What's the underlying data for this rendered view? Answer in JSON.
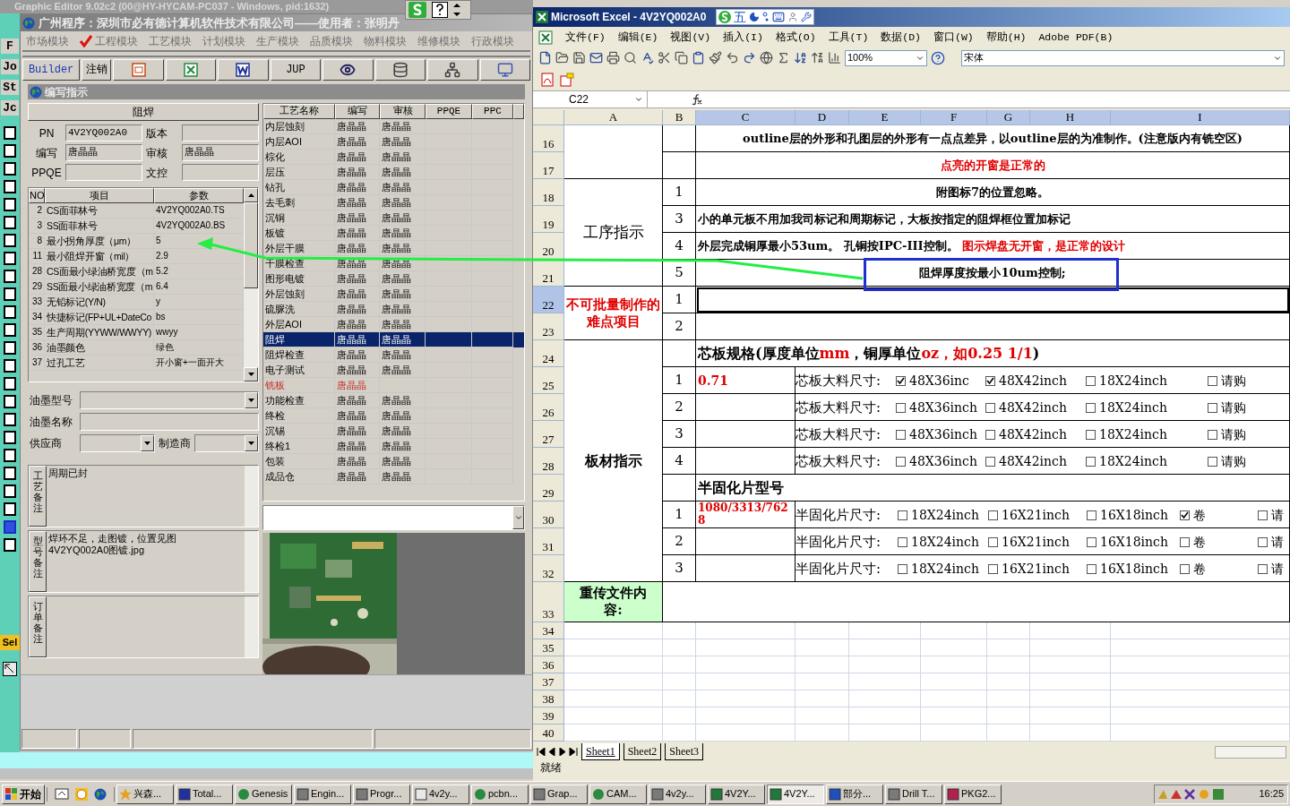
{
  "editor": {
    "title": "Graphic Editor 9.02c2 (00@HY-HYCAM-PC037 - Windows, pid:1632)",
    "side_labels": [
      "F",
      "Jo",
      "St",
      "Jc"
    ],
    "tool_label": "Sel",
    "tools": [
      {
        "selected": false
      },
      {
        "selected": false
      },
      {
        "selected": false
      },
      {
        "selected": false
      },
      {
        "selected": false
      },
      {
        "selected": false
      },
      {
        "selected": false
      },
      {
        "selected": false
      },
      {
        "selected": false
      },
      {
        "selected": false
      },
      {
        "selected": false
      },
      {
        "selected": false
      },
      {
        "selected": false
      },
      {
        "selected": false
      },
      {
        "selected": false
      },
      {
        "selected": false
      },
      {
        "selected": false
      },
      {
        "selected": false
      },
      {
        "selected": false
      },
      {
        "selected": false
      },
      {
        "selected": false
      },
      {
        "selected": false
      },
      {
        "selected": true
      },
      {
        "selected": false
      }
    ]
  },
  "left_window": {
    "title": "广州程序：深圳市必有德计算机软件技术有限公司——使用者：张明丹",
    "modules": [
      {
        "label": "市场模块",
        "selected": false
      },
      {
        "label": "工程模块",
        "selected": true
      },
      {
        "label": "工艺模块",
        "selected": false
      },
      {
        "label": "计划模块",
        "selected": false
      },
      {
        "label": "生产模块",
        "selected": false
      },
      {
        "label": "品质模块",
        "selected": false
      },
      {
        "label": "物料模块",
        "selected": false
      },
      {
        "label": "维修模块",
        "selected": false
      },
      {
        "label": "行政模块",
        "selected": false
      }
    ],
    "toolbar": [
      {
        "kind": "link",
        "label": "Builder"
      },
      {
        "kind": "text",
        "label": "注销"
      },
      {
        "kind": "slides"
      },
      {
        "kind": "sheet"
      },
      {
        "kind": "doc"
      },
      {
        "kind": "text",
        "label": "JUP"
      },
      {
        "kind": "eye"
      },
      {
        "kind": "database"
      },
      {
        "kind": "network"
      },
      {
        "kind": "computer"
      }
    ],
    "inner_title": "编写指示",
    "process_header": "阻焊",
    "fields": [
      {
        "label": "PN",
        "value": "4V2YQ002A0"
      },
      {
        "label": "版本"
      },
      {
        "label": "编写",
        "value": "唐晶晶"
      },
      {
        "label": "审核",
        "value": "唐晶晶"
      },
      {
        "label": "PPQE"
      },
      {
        "label": "文控"
      }
    ],
    "params": {
      "columns": [
        "NO",
        "项目",
        "参数"
      ],
      "rows": [
        [
          "2",
          "CS面菲林号",
          "4V2YQ002A0.TS"
        ],
        [
          "3",
          "SS面菲林号",
          "4V2YQ002A0.BS"
        ],
        [
          "8",
          "最小拐角厚度（μm）",
          "5"
        ],
        [
          "11",
          "最小阻焊开窗（mil）",
          "2.9"
        ],
        [
          "28",
          "CS面最小绿油桥宽度（m",
          "5.2"
        ],
        [
          "29",
          "SS面最小绿油桥宽度（m",
          "6.4"
        ],
        [
          "33",
          "无铅标记(Y/N)",
          "y"
        ],
        [
          "34",
          "快捷标记(FP+UL+DateCo",
          "bs"
        ],
        [
          "35",
          "生产周期(YYWW/WWYY)",
          "wwyy"
        ],
        [
          "36",
          "油墨颜色",
          "绿色"
        ],
        [
          "37",
          "过孔工艺",
          "开小窗+一面开大"
        ]
      ]
    },
    "ink_type": {
      "label": "油墨型号"
    },
    "ink_name": {
      "label": "油墨名称"
    },
    "supplier": {
      "label": "供应商"
    },
    "maker": {
      "label": "制造商"
    },
    "remarks": [
      {
        "label": "工艺备注",
        "lines": [
          "周期已封"
        ]
      },
      {
        "label": "型号备注",
        "lines": [
          "焊环不足，走图镀，位置见图",
          "4V2YQ002A0图镀.jpg"
        ]
      },
      {
        "label": "订单备注"
      }
    ],
    "process_table": {
      "columns": [
        "工艺名称",
        "编写",
        "审核",
        "PPQE",
        "PPC"
      ],
      "rows": [
        {
          "name": "内层蚀刻",
          "writer": "唐晶晶",
          "reviewer": "唐晶晶",
          "selected": false,
          "flagged": false
        },
        {
          "name": "内层AOI",
          "writer": "唐晶晶",
          "reviewer": "唐晶晶",
          "selected": false,
          "flagged": false
        },
        {
          "name": "棕化",
          "writer": "唐晶晶",
          "reviewer": "唐晶晶",
          "selected": false,
          "flagged": false
        },
        {
          "name": "层压",
          "writer": "唐晶晶",
          "reviewer": "唐晶晶",
          "selected": false,
          "flagged": false
        },
        {
          "name": "钻孔",
          "writer": "唐晶晶",
          "reviewer": "唐晶晶",
          "selected": false,
          "flagged": false
        },
        {
          "name": "去毛刺",
          "writer": "唐晶晶",
          "reviewer": "唐晶晶",
          "selected": false,
          "flagged": false
        },
        {
          "name": "沉铜",
          "writer": "唐晶晶",
          "reviewer": "唐晶晶",
          "selected": false,
          "flagged": false
        },
        {
          "name": "板镀",
          "writer": "唐晶晶",
          "reviewer": "唐晶晶",
          "selected": false,
          "flagged": false
        },
        {
          "name": "外层干膜",
          "writer": "唐晶晶",
          "reviewer": "唐晶晶",
          "selected": false,
          "flagged": false
        },
        {
          "name": "干膜检查",
          "writer": "唐晶晶",
          "reviewer": "唐晶晶",
          "selected": false,
          "flagged": false
        },
        {
          "name": "图形电镀",
          "writer": "唐晶晶",
          "reviewer": "唐晶晶",
          "selected": false,
          "flagged": false
        },
        {
          "name": "外层蚀刻",
          "writer": "唐晶晶",
          "reviewer": "唐晶晶",
          "selected": false,
          "flagged": false
        },
        {
          "name": "硫脲洗",
          "writer": "唐晶晶",
          "reviewer": "唐晶晶",
          "selected": false,
          "flagged": false
        },
        {
          "name": "外层AOI",
          "writer": "唐晶晶",
          "reviewer": "唐晶晶",
          "selected": false,
          "flagged": false
        },
        {
          "name": "阻焊",
          "writer": "唐晶晶",
          "reviewer": "唐晶晶",
          "selected": true,
          "flagged": false
        },
        {
          "name": "阻焊检查",
          "writer": "唐晶晶",
          "reviewer": "唐晶晶",
          "selected": false,
          "flagged": false
        },
        {
          "name": "电子测试",
          "writer": "唐晶晶",
          "reviewer": "唐晶晶",
          "selected": false,
          "flagged": false
        },
        {
          "name": "铣板",
          "writer": "唐晶晶",
          "selected": false,
          "flagged": true
        },
        {
          "name": "功能检查",
          "writer": "唐晶晶",
          "reviewer": "唐晶晶",
          "selected": false,
          "flagged": false
        },
        {
          "name": "终检",
          "writer": "唐晶晶",
          "reviewer": "唐晶晶",
          "selected": false,
          "flagged": false
        },
        {
          "name": "沉锡",
          "writer": "唐晶晶",
          "reviewer": "唐晶晶",
          "selected": false,
          "flagged": false
        },
        {
          "name": "终检1",
          "writer": "唐晶晶",
          "reviewer": "唐晶晶",
          "selected": false,
          "flagged": false
        },
        {
          "name": "包装",
          "writer": "唐晶晶",
          "reviewer": "唐晶晶",
          "selected": false,
          "flagged": false
        },
        {
          "name": "成品仓",
          "writer": "唐晶晶",
          "reviewer": "唐晶晶",
          "selected": false,
          "flagged": false
        }
      ]
    }
  },
  "excel": {
    "title": "Microsoft Excel - 4V2YQ002A0",
    "ime_mode": "五",
    "menu": [
      "文件(F)",
      "编辑(E)",
      "视图(V)",
      "插入(I)",
      "格式(O)",
      "工具(T)",
      "数据(D)",
      "窗口(W)",
      "帮助(H)",
      "Adobe PDF(B)"
    ],
    "zoom": "100%",
    "font": "宋体",
    "cell_ref": "C22",
    "columns": [
      {
        "label": "A",
        "selected": false
      },
      {
        "label": "B",
        "selected": false
      },
      {
        "label": "C",
        "selected": true
      },
      {
        "label": "D",
        "selected": true
      },
      {
        "label": "E",
        "selected": true
      },
      {
        "label": "F",
        "selected": true
      },
      {
        "label": "G",
        "selected": true
      },
      {
        "label": "H",
        "selected": true
      },
      {
        "label": "I",
        "selected": true
      }
    ],
    "row_numbers": [
      {
        "label": "16",
        "selected": false
      },
      {
        "label": "17",
        "selected": false
      },
      {
        "label": "18",
        "selected": false
      },
      {
        "label": "19",
        "selected": false
      },
      {
        "label": "20",
        "selected": false
      },
      {
        "label": "21",
        "selected": false
      },
      {
        "label": "22",
        "selected": true
      },
      {
        "label": "23",
        "selected": false
      },
      {
        "label": "24",
        "selected": false
      },
      {
        "label": "25",
        "selected": false
      },
      {
        "label": "26",
        "selected": false
      },
      {
        "label": "27",
        "selected": false
      },
      {
        "label": "28",
        "selected": false
      },
      {
        "label": "29",
        "selected": false
      },
      {
        "label": "30",
        "selected": false
      },
      {
        "label": "31",
        "selected": false
      },
      {
        "label": "32",
        "selected": false
      },
      {
        "label": "33",
        "selected": false
      },
      {
        "label": "34",
        "selected": false
      },
      {
        "label": "35",
        "selected": false
      },
      {
        "label": "36",
        "selected": false
      },
      {
        "label": "37",
        "selected": false
      },
      {
        "label": "38",
        "selected": false
      },
      {
        "label": "39",
        "selected": false
      },
      {
        "label": "40",
        "selected": false
      }
    ],
    "process": {
      "label": "工序指示",
      "notes": [
        {
          "kind": "center",
          "boxed": false,
          "parts": [
            {
              "text": "outline层的外形和孔图层的外形有一点点差异，以outline层的为准制作。(注意版内有铣空区)",
              "alert": false
            }
          ]
        },
        {
          "kind": "center",
          "boxed": false,
          "parts": [
            {
              "text": "点亮的开窗是正常的",
              "alert": true
            }
          ]
        },
        {
          "kind": "center",
          "no": "1",
          "boxed": false,
          "parts": [
            {
              "text": "附图标7的位置忽略。",
              "alert": false
            }
          ]
        },
        {
          "kind": "left",
          "no": "3",
          "boxed": false,
          "parts": [
            {
              "text": "小的单元板不用加我司标记和周期标记，大板按指定的阻焊框位置加标记",
              "alert": false
            }
          ]
        },
        {
          "kind": "left",
          "no": "4",
          "boxed": false,
          "parts": [
            {
              "text": "外层完成铜厚最小53um。 孔铜按IPC-III控制。 ",
              "alert": false
            },
            {
              "text": "图示焊盘无开窗，是正常的设计",
              "alert": true
            }
          ]
        },
        {
          "kind": "center",
          "no": "5",
          "boxed": true,
          "parts": [
            {
              "text": "阻焊厚度按最小10um控制;",
              "alert": false
            }
          ]
        }
      ]
    },
    "hard_items": {
      "label": "不可批量制作的难点项目",
      "rows": [
        {
          "no": "1",
          "selected": true
        },
        {
          "no": "2",
          "selected": false
        }
      ]
    },
    "material": {
      "label": "板材指示",
      "core_heading": [
        {
          "text": "芯板规格(厚度单位",
          "alert": false
        },
        {
          "text": "mm",
          "alert": true
        },
        {
          "text": "，铜厚单位",
          "alert": false
        },
        {
          "text": "oz，如0.25 1/1",
          "alert": true
        },
        {
          "text": ")",
          "alert": false
        }
      ],
      "core_rows": [
        {
          "no": "1",
          "value": "0.71",
          "label": "芯板大料尺寸:",
          "options": [
            {
              "label": "48X36inc",
              "checked": true
            },
            {
              "label": "48X42inch",
              "checked": true
            },
            {
              "label": "18X24inch",
              "checked": false
            },
            {
              "label": "请购",
              "checked": false
            }
          ]
        },
        {
          "no": "2",
          "label": "芯板大料尺寸:",
          "options": [
            {
              "label": "48X36inch",
              "checked": false
            },
            {
              "label": "48X42inch",
              "checked": false
            },
            {
              "label": "18X24inch",
              "checked": false
            },
            {
              "label": "请购",
              "checked": false
            }
          ]
        },
        {
          "no": "3",
          "label": "芯板大料尺寸:",
          "options": [
            {
              "label": "48X36inch",
              "checked": false
            },
            {
              "label": "48X42inch",
              "checked": false
            },
            {
              "label": "18X24inch",
              "checked": false
            },
            {
              "label": "请购",
              "checked": false
            }
          ]
        },
        {
          "no": "4",
          "label": "芯板大料尺寸:",
          "options": [
            {
              "label": "48X36inch",
              "checked": false
            },
            {
              "label": "48X42inch",
              "checked": false
            },
            {
              "label": "18X24inch",
              "checked": false
            },
            {
              "label": "请购",
              "checked": false
            }
          ]
        }
      ],
      "prepreg_heading": "半固化片型号",
      "prepreg_rows": [
        {
          "no": "1",
          "value": "1080/3313/7628",
          "label": "半固化片尺寸:",
          "options": [
            {
              "label": "18X24inch",
              "checked": false
            },
            {
              "label": "16X21inch",
              "checked": false
            },
            {
              "label": "16X18inch",
              "checked": false
            },
            {
              "label": "卷",
              "checked": true
            },
            {
              "label": "请",
              "checked": false
            }
          ]
        },
        {
          "no": "2",
          "label": "半固化片尺寸:",
          "options": [
            {
              "label": "18X24inch",
              "checked": false
            },
            {
              "label": "16X21inch",
              "checked": false
            },
            {
              "label": "16X18inch",
              "checked": false
            },
            {
              "label": "卷",
              "checked": false
            },
            {
              "label": "请",
              "checked": false
            }
          ]
        },
        {
          "no": "3",
          "label": "半固化片尺寸:",
          "options": [
            {
              "label": "18X24inch",
              "checked": false
            },
            {
              "label": "16X21inch",
              "checked": false
            },
            {
              "label": "16X18inch",
              "checked": false
            },
            {
              "label": "卷",
              "checked": false
            },
            {
              "label": "请",
              "checked": false
            }
          ]
        }
      ]
    },
    "reupload": {
      "label": "重传文件内容:"
    },
    "sheets": [
      {
        "label": "Sheet1",
        "selected": true
      },
      {
        "label": "Sheet2",
        "selected": false
      },
      {
        "label": "Sheet3",
        "selected": false
      }
    ],
    "status": "就绪"
  },
  "taskbar": {
    "start": "开始",
    "tasks": [
      {
        "kind": "star",
        "label": "兴森...",
        "selected": false
      },
      {
        "kind": "disk",
        "label": "Total...",
        "selected": false
      },
      {
        "kind": "globe",
        "label": "Genesis",
        "selected": false
      },
      {
        "kind": "window",
        "label": "Engin...",
        "selected": false
      },
      {
        "kind": "window",
        "label": "Progr...",
        "selected": false
      },
      {
        "kind": "doc",
        "label": "4v2y...",
        "selected": false
      },
      {
        "kind": "globe",
        "label": "pcbn...",
        "selected": false
      },
      {
        "kind": "window",
        "label": "Grap...",
        "selected": false
      },
      {
        "kind": "globe",
        "label": "CAM...",
        "selected": false
      },
      {
        "kind": "window",
        "label": "4v2y...",
        "selected": false
      },
      {
        "kind": "sheet",
        "label": "4V2Y...",
        "selected": false
      },
      {
        "kind": "sheet",
        "label": "4V2Y...",
        "selected": true
      },
      {
        "kind": "word",
        "label": "部分...",
        "selected": false
      },
      {
        "kind": "window",
        "label": "Drill T...",
        "selected": false
      },
      {
        "kind": "archive",
        "label": "PKG2...",
        "selected": false
      }
    ],
    "time": "16:25"
  }
}
